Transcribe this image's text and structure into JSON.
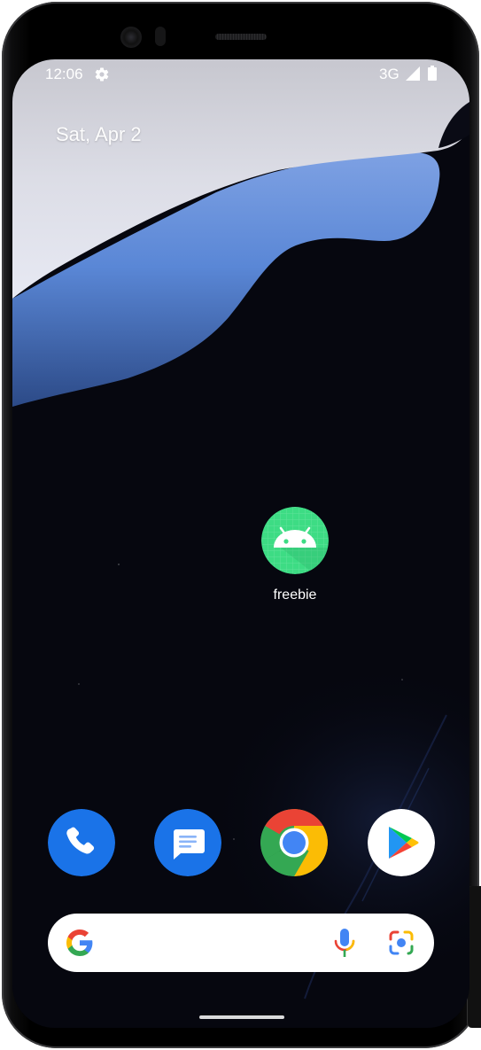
{
  "status_bar": {
    "time": "12:06",
    "settings_icon": "gear-icon",
    "network": "3G",
    "signal_icon": "signal-icon",
    "battery_icon": "battery-icon"
  },
  "home": {
    "date": "Sat, Apr 2",
    "apps": [
      {
        "label": "freebie",
        "icon": "android-icon",
        "icon_color": "#3ddc84"
      }
    ]
  },
  "dock": {
    "items": [
      {
        "name": "phone",
        "icon": "phone-icon",
        "color": "#1a73e8"
      },
      {
        "name": "messages",
        "icon": "messages-icon",
        "color": "#1a73e8"
      },
      {
        "name": "chrome",
        "icon": "chrome-icon"
      },
      {
        "name": "play-store",
        "icon": "play-store-icon"
      }
    ]
  },
  "search": {
    "logo": "google-g-icon",
    "mic": "mic-icon",
    "lens": "google-lens-icon"
  },
  "colors": {
    "wallpaper_dark": "#06070f",
    "wallpaper_blue": "#5a87d6",
    "search_bg": "#ffffff"
  }
}
